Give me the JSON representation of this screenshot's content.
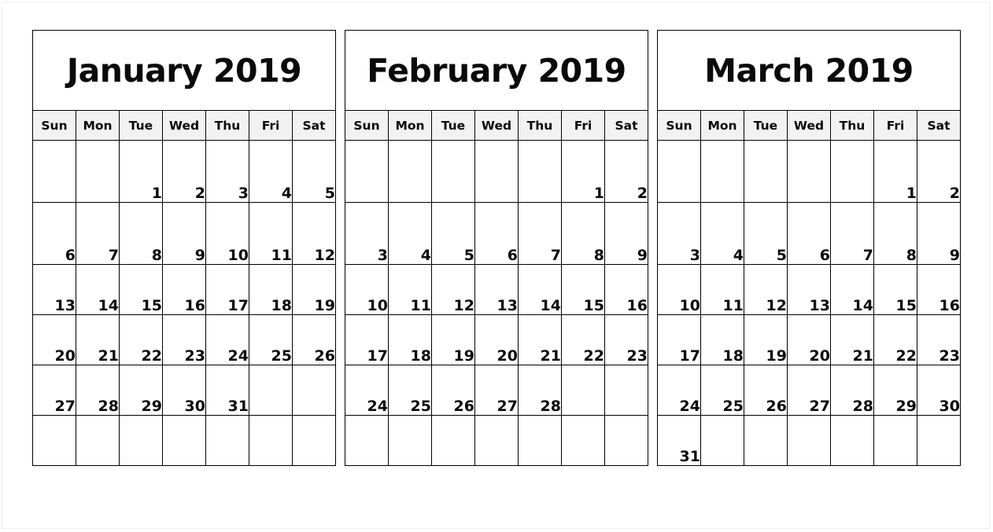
{
  "page": {
    "title": "January February March 2019 Calendar",
    "background_color": "#ffffff",
    "grid_line_color": "#000000",
    "header_fill_color": "#f2f2f2",
    "text_color": "#0a0a0a"
  },
  "weekdays": [
    "Sun",
    "Mon",
    "Tue",
    "Wed",
    "Thu",
    "Fri",
    "Sat"
  ],
  "watermark": {
    "line1": "",
    "line2": ""
  },
  "months": [
    {
      "title": "January 2019",
      "name": "January",
      "year": "2019",
      "weeks": [
        [
          "",
          "",
          "1",
          "2",
          "3",
          "4",
          "5"
        ],
        [
          "6",
          "7",
          "8",
          "9",
          "10",
          "11",
          "12"
        ],
        [
          "13",
          "14",
          "15",
          "16",
          "17",
          "18",
          "19"
        ],
        [
          "20",
          "21",
          "22",
          "23",
          "24",
          "25",
          "26"
        ],
        [
          "27",
          "28",
          "29",
          "30",
          "31",
          "",
          ""
        ],
        [
          "",
          "",
          "",
          "",
          "",
          "",
          ""
        ]
      ]
    },
    {
      "title": "February 2019",
      "name": "February",
      "year": "2019",
      "weeks": [
        [
          "",
          "",
          "",
          "",
          "",
          "1",
          "2"
        ],
        [
          "3",
          "4",
          "5",
          "6",
          "7",
          "8",
          "9"
        ],
        [
          "10",
          "11",
          "12",
          "13",
          "14",
          "15",
          "16"
        ],
        [
          "17",
          "18",
          "19",
          "20",
          "21",
          "22",
          "23"
        ],
        [
          "24",
          "25",
          "26",
          "27",
          "28",
          "",
          ""
        ],
        [
          "",
          "",
          "",
          "",
          "",
          "",
          ""
        ]
      ]
    },
    {
      "title": "March 2019",
      "name": "March",
      "year": "2019",
      "weeks": [
        [
          "",
          "",
          "",
          "",
          "",
          "1",
          "2"
        ],
        [
          "3",
          "4",
          "5",
          "6",
          "7",
          "8",
          "9"
        ],
        [
          "10",
          "11",
          "12",
          "13",
          "14",
          "15",
          "16"
        ],
        [
          "17",
          "18",
          "19",
          "20",
          "21",
          "22",
          "23"
        ],
        [
          "24",
          "25",
          "26",
          "27",
          "28",
          "29",
          "30"
        ],
        [
          "31",
          "",
          "",
          "",
          "",
          "",
          ""
        ]
      ]
    }
  ]
}
